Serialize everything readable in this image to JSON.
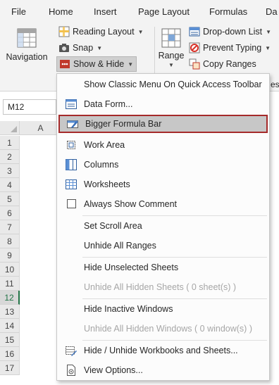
{
  "tabs": [
    {
      "label": "File"
    },
    {
      "label": "Home"
    },
    {
      "label": "Insert"
    },
    {
      "label": "Page Layout"
    },
    {
      "label": "Formulas"
    },
    {
      "label": "Da"
    }
  ],
  "ribbon": {
    "navigation_label": "Navigation",
    "reading_layout_label": "Reading Layout",
    "snap_label": "Snap",
    "show_hide_label": "Show & Hide",
    "range_label": "Range",
    "dropdown_list_label": "Drop-down List",
    "prevent_typing_label": "Prevent Typing",
    "copy_ranges_label": "Copy Ranges",
    "partial_right_text": "es &"
  },
  "namebox": {
    "value": "M12"
  },
  "grid": {
    "col_a": "A",
    "rows": [
      "1",
      "2",
      "3",
      "4",
      "5",
      "6",
      "7",
      "8",
      "9",
      "10",
      "11",
      "12",
      "13",
      "14",
      "15",
      "16",
      "17"
    ],
    "active_row": "12"
  },
  "menu": {
    "items": [
      {
        "label": "Show Classic Menu On Quick Access Toolbar",
        "icon": "none",
        "enabled": true
      },
      {
        "label": "Data Form...",
        "icon": "form-icon",
        "enabled": true
      },
      {
        "label": "Bigger Formula Bar",
        "icon": "formula-bar-icon",
        "enabled": true,
        "highlighted": true
      },
      {
        "label": "Work Area",
        "icon": "work-area-icon",
        "enabled": true
      },
      {
        "label": "Columns",
        "icon": "columns-icon",
        "enabled": true
      },
      {
        "label": "Worksheets",
        "icon": "worksheets-icon",
        "enabled": true
      },
      {
        "label": "Always Show Comment",
        "icon": "checkbox",
        "enabled": true
      },
      {
        "label": "Set Scroll Area",
        "icon": "none",
        "enabled": true
      },
      {
        "label": "Unhide All Ranges",
        "icon": "none",
        "enabled": true
      },
      {
        "label": "Hide Unselected Sheets",
        "icon": "none",
        "enabled": true
      },
      {
        "label": "Unhide All Hidden Sheets ( 0 sheet(s) )",
        "icon": "none",
        "enabled": false
      },
      {
        "label": "Hide Inactive Windows",
        "icon": "none",
        "enabled": true
      },
      {
        "label": "Unhide All Hidden Windows ( 0 window(s) )",
        "icon": "none",
        "enabled": false
      },
      {
        "label": "Hide / Unhide Workbooks and Sheets...",
        "icon": "workbooks-icon",
        "enabled": true
      },
      {
        "label": "View Options...",
        "icon": "view-options-icon",
        "enabled": true
      }
    ]
  },
  "colors": {
    "accent_green": "#217346",
    "highlight_border": "#a52a2a",
    "highlight_fill": "#c7c7c7",
    "ribbon_bg": "#f3f3f3"
  }
}
